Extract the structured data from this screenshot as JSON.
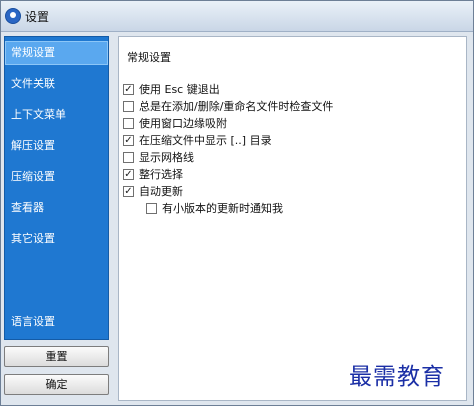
{
  "window": {
    "title": "设置"
  },
  "sidebar": {
    "items": [
      {
        "label": "常规设置",
        "active": true
      },
      {
        "label": "文件关联",
        "active": false
      },
      {
        "label": "上下文菜单",
        "active": false
      },
      {
        "label": "解压设置",
        "active": false
      },
      {
        "label": "压缩设置",
        "active": false
      },
      {
        "label": "查看器",
        "active": false
      },
      {
        "label": "其它设置",
        "active": false
      }
    ],
    "bottom_item": {
      "label": "语言设置"
    },
    "colors": {
      "background": "#1f78d1",
      "active": "#5aa8ef"
    }
  },
  "buttons": {
    "reset_label": "重置",
    "ok_label": "确定"
  },
  "panel": {
    "title": "常规设置",
    "options": [
      {
        "label": "使用 Esc 键退出",
        "checked": true
      },
      {
        "label": "总是在添加/删除/重命名文件时检查文件",
        "checked": false
      },
      {
        "label": "使用窗口边缘吸附",
        "checked": false
      },
      {
        "label": "在压缩文件中显示 [..] 目录",
        "checked": true
      },
      {
        "label": "显示网格线",
        "checked": false
      },
      {
        "label": "整行选择",
        "checked": true
      },
      {
        "label": "自动更新",
        "checked": true
      },
      {
        "label": "有小版本的更新时通知我",
        "checked": false
      }
    ]
  },
  "watermark": {
    "text": "最需教育"
  },
  "icons": {
    "app": "app-logo-icon",
    "checkbox": "checkbox-icon"
  }
}
